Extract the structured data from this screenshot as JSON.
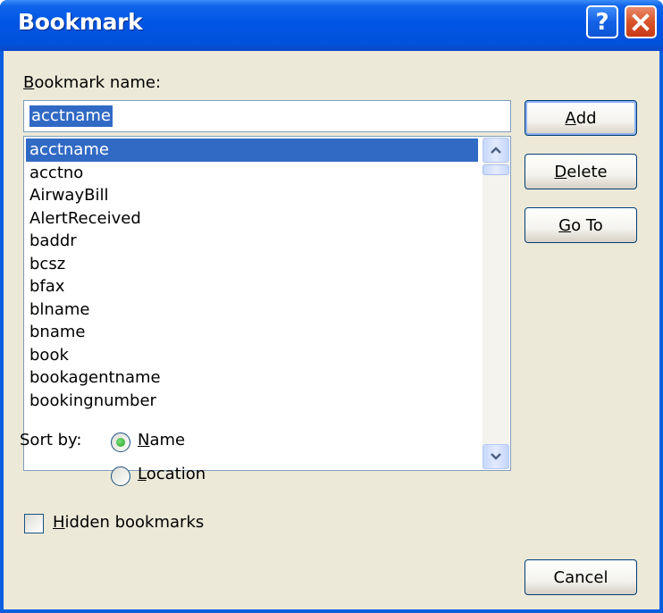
{
  "window": {
    "title": "Bookmark"
  },
  "titlebar": {
    "help_glyph": "?",
    "help_icon": "help-icon",
    "close_icon": "close-icon"
  },
  "form": {
    "name_label_prefix": "B",
    "name_label_rest": "ookmark name:",
    "name_value": "acctname",
    "list_items": [
      "acctname",
      "acctno",
      "AirwayBill",
      "AlertReceived",
      "baddr",
      "bcsz",
      "bfax",
      "blname",
      "bname",
      "book",
      "bookagentname",
      "bookingnumber"
    ],
    "selected_item": "acctname"
  },
  "buttons": {
    "add": {
      "mnemonic": "A",
      "rest": "dd"
    },
    "delete": {
      "mnemonic": "D",
      "rest": "elete"
    },
    "goto": {
      "mnemonic": "G",
      "rest": "o To"
    },
    "cancel": "Cancel"
  },
  "sort": {
    "label": "Sort by:",
    "name_option": {
      "mnemonic": "N",
      "rest": "ame",
      "selected": true
    },
    "location_option": {
      "mnemonic": "L",
      "rest": "ocation",
      "selected": false
    }
  },
  "hidden": {
    "mnemonic": "H",
    "rest": "idden bookmarks",
    "checked": false
  },
  "colors": {
    "title_bar": "#0055e4",
    "selection": "#316ac5",
    "dialog_bg": "#ece9d8",
    "close_button": "#d9542a"
  }
}
